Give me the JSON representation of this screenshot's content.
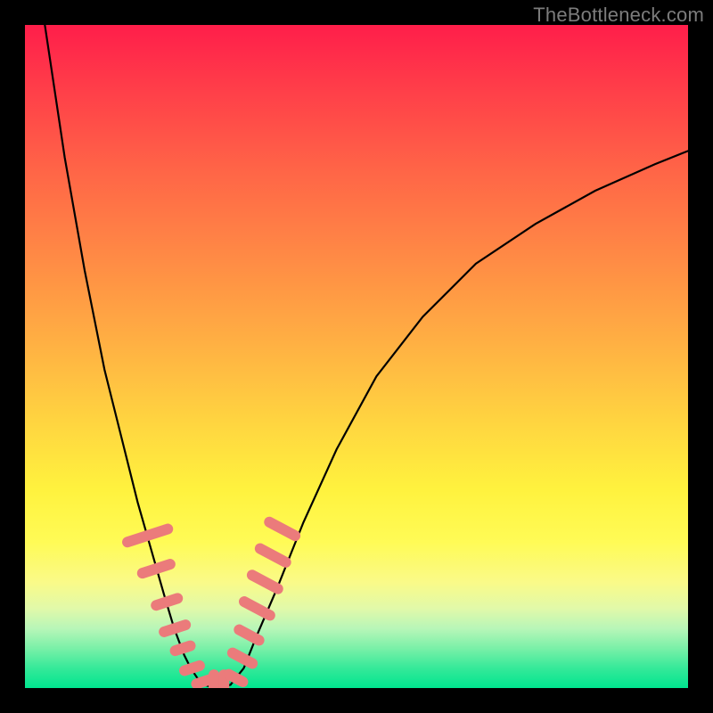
{
  "watermark": "TheBottleneck.com",
  "colors": {
    "background": "#000000",
    "gradient_top": "#ff1e4a",
    "gradient_bottom": "#00e58f",
    "curve": "#000000",
    "bead": "#eb7b7b",
    "watermark_text": "#7c7c7c"
  },
  "chart_data": {
    "type": "line",
    "title": "",
    "xlabel": "",
    "ylabel": "",
    "xlim": [
      0,
      100
    ],
    "ylim": [
      0,
      100
    ],
    "legend": false,
    "grid": false,
    "annotations": [
      "TheBottleneck.com"
    ],
    "series": [
      {
        "name": "left-branch",
        "x": [
          3,
          6,
          9,
          12,
          15,
          17,
          19,
          21,
          22.5,
          24,
          25,
          26,
          27
        ],
        "y": [
          100,
          80,
          63,
          48,
          36,
          28,
          21,
          14,
          9,
          5,
          3,
          1.5,
          0.5
        ]
      },
      {
        "name": "valley-floor",
        "x": [
          27,
          28,
          29,
          30,
          31
        ],
        "y": [
          0.5,
          0.2,
          0.2,
          0.2,
          0.5
        ]
      },
      {
        "name": "right-branch",
        "x": [
          31,
          33,
          35,
          38,
          42,
          47,
          53,
          60,
          68,
          77,
          86,
          95,
          100
        ],
        "y": [
          0.5,
          3,
          8,
          15,
          25,
          36,
          47,
          56,
          64,
          70,
          75,
          79,
          81
        ]
      }
    ],
    "markers": {
      "name": "highlighted-points",
      "shape": "rounded-pill",
      "color": "#eb7b7b",
      "points": [
        {
          "x": 18.5,
          "y": 23,
          "len": 8
        },
        {
          "x": 19.8,
          "y": 18,
          "len": 6
        },
        {
          "x": 21.4,
          "y": 13,
          "len": 5
        },
        {
          "x": 22.6,
          "y": 9,
          "len": 5
        },
        {
          "x": 23.8,
          "y": 6,
          "len": 4
        },
        {
          "x": 25.2,
          "y": 3,
          "len": 4
        },
        {
          "x": 27.0,
          "y": 1,
          "len": 4
        },
        {
          "x": 28.5,
          "y": 0.3,
          "len": 5
        },
        {
          "x": 30.0,
          "y": 0.3,
          "len": 5
        },
        {
          "x": 31.8,
          "y": 1.5,
          "len": 4
        },
        {
          "x": 32.8,
          "y": 4.5,
          "len": 5
        },
        {
          "x": 33.8,
          "y": 8,
          "len": 5
        },
        {
          "x": 35.0,
          "y": 12,
          "len": 6
        },
        {
          "x": 36.2,
          "y": 16,
          "len": 6
        },
        {
          "x": 37.4,
          "y": 20,
          "len": 6
        },
        {
          "x": 38.8,
          "y": 24,
          "len": 6
        }
      ]
    }
  }
}
